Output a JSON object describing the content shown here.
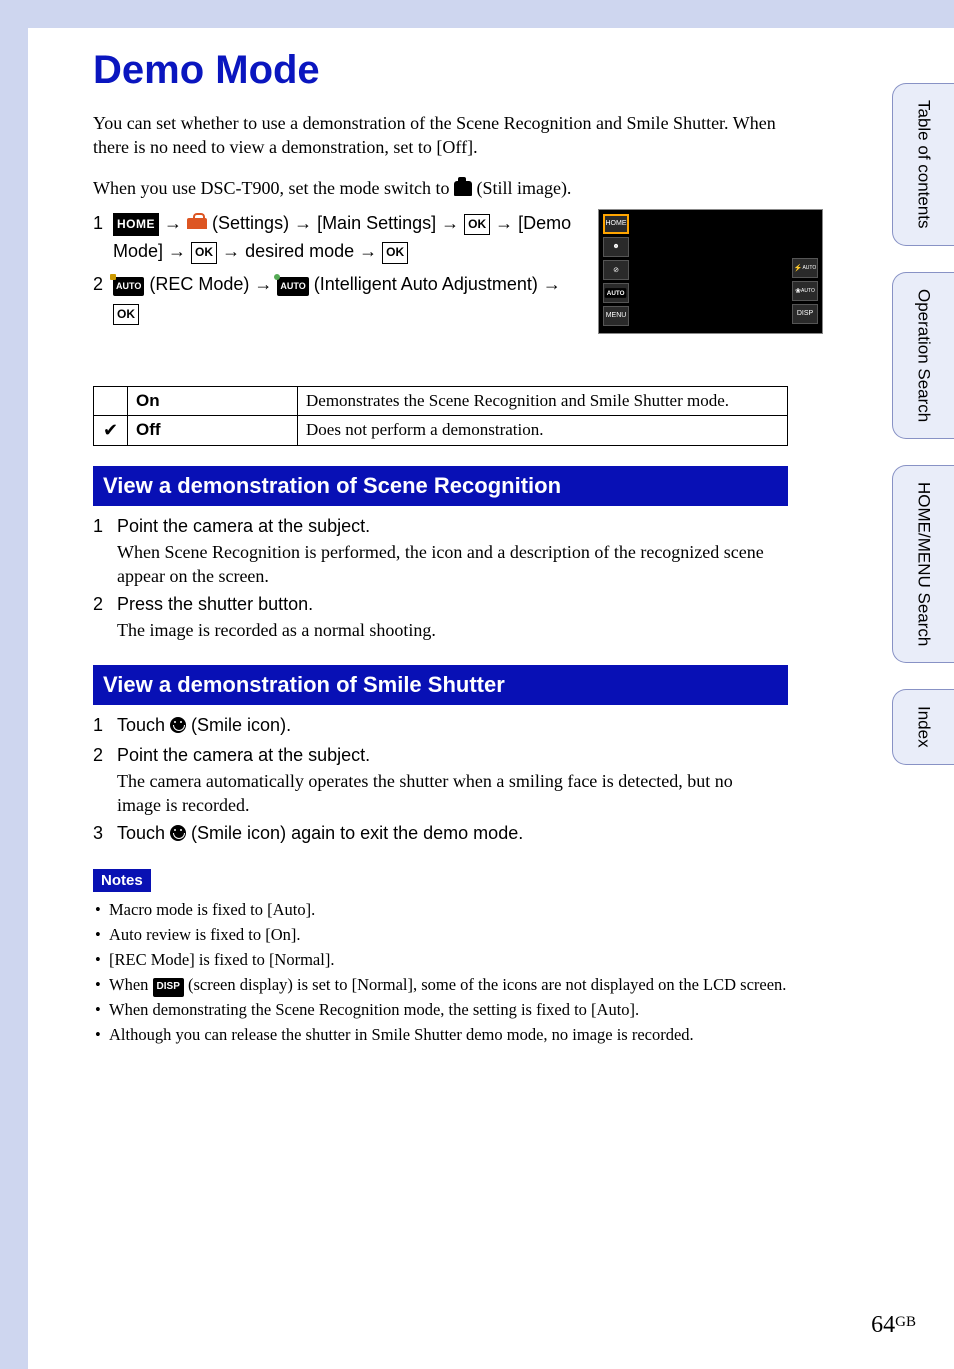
{
  "title": "Demo Mode",
  "intro": "You can set whether to use a demonstration of the Scene Recognition and Smile Shutter. When there is no need to view a demonstration, set to [Off].",
  "intro2_pre": "When you use DSC-T900, set the mode switch to ",
  "intro2_post": " (Still image).",
  "step1": {
    "home": "HOME",
    "settings_label": " (Settings) ",
    "main_settings": " [Main Settings] ",
    "ok": "OK",
    "demo_mode": " [Demo Mode] ",
    "desired": " desired mode "
  },
  "step2": {
    "rec_mode": " (REC Mode) ",
    "auto_label": "AUTO",
    "intel": " (Intelligent Auto Adjustment) "
  },
  "lcd": {
    "home": "HOME",
    "smile": "☻",
    "off": "⊘",
    "menu": "MENU",
    "flash": "⚡",
    "disp": "DISP"
  },
  "table": {
    "on": "On",
    "on_desc": "Demonstrates the Scene Recognition and Smile Shutter mode.",
    "off": "Off",
    "off_desc": "Does not perform a demonstration.",
    "check": "✔"
  },
  "section_scene": "View a demonstration of Scene Recognition",
  "scene_steps": [
    {
      "n": "1",
      "line1": "Point the camera at the subject.",
      "line2": "When Scene Recognition is performed, the icon and a description of the recognized scene appear on the screen."
    },
    {
      "n": "2",
      "line1": "Press the shutter button.",
      "line2": "The image is recorded as a normal shooting."
    }
  ],
  "section_smile": "View a demonstration of Smile Shutter",
  "smile_steps": [
    {
      "n": "1",
      "pre": "Touch ",
      "post": " (Smile icon)."
    },
    {
      "n": "2",
      "line1": "Point the camera at the subject.",
      "line2": "The camera automatically operates the shutter when a smiling face is detected, but no image is recorded."
    },
    {
      "n": "3",
      "pre": "Touch ",
      "post": " (Smile icon) again to exit the demo mode."
    }
  ],
  "notes_label": "Notes",
  "notes": [
    "Macro mode is fixed to [Auto].",
    "Auto review is fixed to [On].",
    "[REC Mode] is fixed to [Normal].",
    {
      "pre": "When ",
      "badge": "DISP",
      "post": " (screen display) is set to [Normal], some of the icons are not displayed on the LCD screen."
    },
    "When demonstrating the Scene Recognition mode, the setting is fixed to [Auto].",
    "Although you can release the shutter in Smile Shutter demo mode, no image is recorded."
  ],
  "tabs": [
    "Table of contents",
    "Operation Search",
    "HOME/MENU Search",
    "Index"
  ],
  "page": {
    "num": "64",
    "suffix": "GB"
  }
}
